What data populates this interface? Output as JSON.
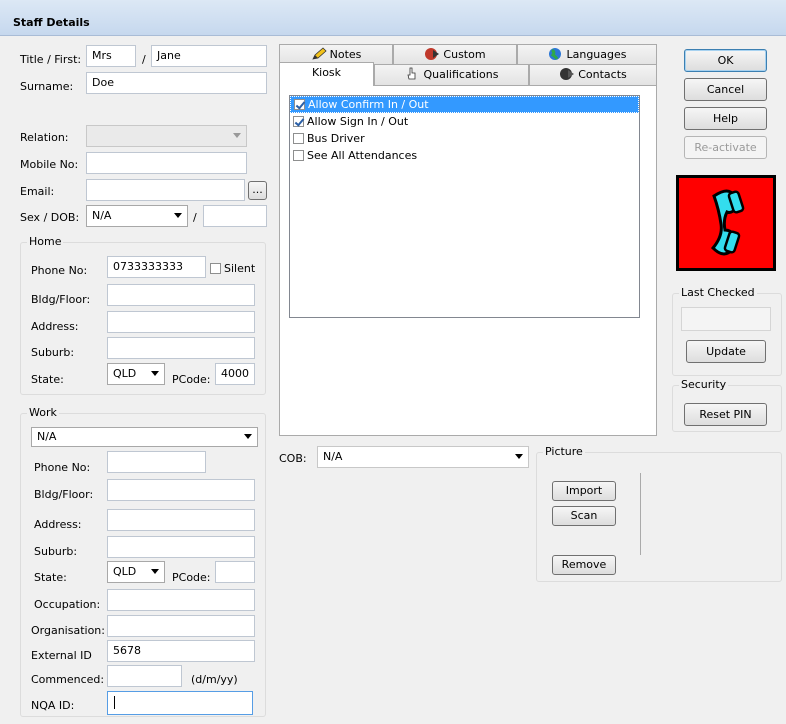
{
  "window": {
    "title": "Staff Details"
  },
  "identity": {
    "title_first_label": "Title / First:",
    "title_value": "Mrs",
    "slash": "/",
    "first_value": "Jane",
    "surname_label": "Surname:",
    "surname_value": "Doe",
    "relation_label": "Relation:",
    "relation_value": "",
    "mobile_label": "Mobile No:",
    "mobile_value": "",
    "email_label": "Email:",
    "email_value": "",
    "email_browse_label": "...",
    "sex_dob_label": "Sex / DOB:",
    "sex_value": "N/A",
    "dob_slash": "/",
    "dob_value": ""
  },
  "home": {
    "title": "Home",
    "phone_label": "Phone No:",
    "phone_value": "0733333333",
    "silent_label": "Silent",
    "silent_checked": false,
    "bldg_label": "Bldg/Floor:",
    "bldg_value": "",
    "address_label": "Address:",
    "address_value": "",
    "suburb_label": "Suburb:",
    "suburb_value": "",
    "state_label": "State:",
    "state_value": "QLD",
    "pcode_label": "PCode:",
    "pcode_value": "4000"
  },
  "work": {
    "title": "Work",
    "employer_value": "N/A",
    "phone_label": "Phone No:",
    "phone_value": "",
    "bldg_label": "Bldg/Floor:",
    "bldg_value": "",
    "address_label": "Address:",
    "address_value": "",
    "suburb_label": "Suburb:",
    "suburb_value": "",
    "state_label": "State:",
    "state_value": "QLD",
    "pcode_label": "PCode:",
    "pcode_value": "",
    "occupation_label": "Occupation:",
    "occupation_value": "",
    "organisation_label": "Organisation:",
    "organisation_value": "",
    "external_id_label": "External ID",
    "external_id_value": "5678",
    "commenced_label": "Commenced:",
    "commenced_value": "",
    "date_format_hint": "(d/m/yy)",
    "nqa_label": "NQA ID:",
    "nqa_value": ""
  },
  "tabs": {
    "notes": "Notes",
    "custom": "Custom",
    "languages": "Languages",
    "kiosk": "Kiosk",
    "qualifications": "Qualifications",
    "contacts": "Contacts"
  },
  "kiosk": {
    "items": [
      {
        "label": "Allow Confirm In / Out",
        "checked": true,
        "selected": true
      },
      {
        "label": "Allow Sign In / Out",
        "checked": true,
        "selected": false
      },
      {
        "label": "Bus Driver",
        "checked": false,
        "selected": false
      },
      {
        "label": "See All Attendances",
        "checked": false,
        "selected": false
      }
    ]
  },
  "cob": {
    "label": "COB:",
    "value": "N/A"
  },
  "picture": {
    "title": "Picture",
    "import_label": "Import",
    "scan_label": "Scan",
    "remove_label": "Remove"
  },
  "actions": {
    "ok_label": "OK",
    "cancel_label": "Cancel",
    "help_label": "Help",
    "reactivate_label": "Re-activate"
  },
  "status_icon": {
    "name": "phone-icon",
    "background": "#ff0000",
    "handset": "#33ddee"
  },
  "last_checked": {
    "title": "Last Checked",
    "value": "",
    "update_label": "Update"
  },
  "security": {
    "title": "Security",
    "reset_pin_label": "Reset PIN"
  }
}
